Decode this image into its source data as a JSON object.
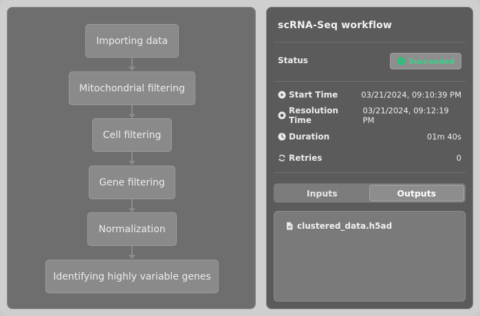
{
  "workflow": {
    "steps": [
      "Importing data",
      "Mitochondrial filtering",
      "Cell filtering",
      "Gene filtering",
      "Normalization",
      "Identifying highly variable genes"
    ]
  },
  "details": {
    "title": "scRNA-Seq workflow",
    "status_label": "Status",
    "status_value": "Succeeded",
    "start_time_label": "Start Time",
    "start_time_value": "03/21/2024, 09:10:39 PM",
    "resolution_time_label": "Resolution Time",
    "resolution_time_value": "03/21/2024, 09:12:19 PM",
    "duration_label": "Duration",
    "duration_value": "01m 40s",
    "retries_label": "Retries",
    "retries_value": "0"
  },
  "tabs": {
    "inputs": "Inputs",
    "outputs": "Outputs",
    "active": "outputs"
  },
  "outputs": {
    "files": [
      "clustered_data.h5ad"
    ]
  },
  "colors": {
    "success": "#3ad28a"
  }
}
